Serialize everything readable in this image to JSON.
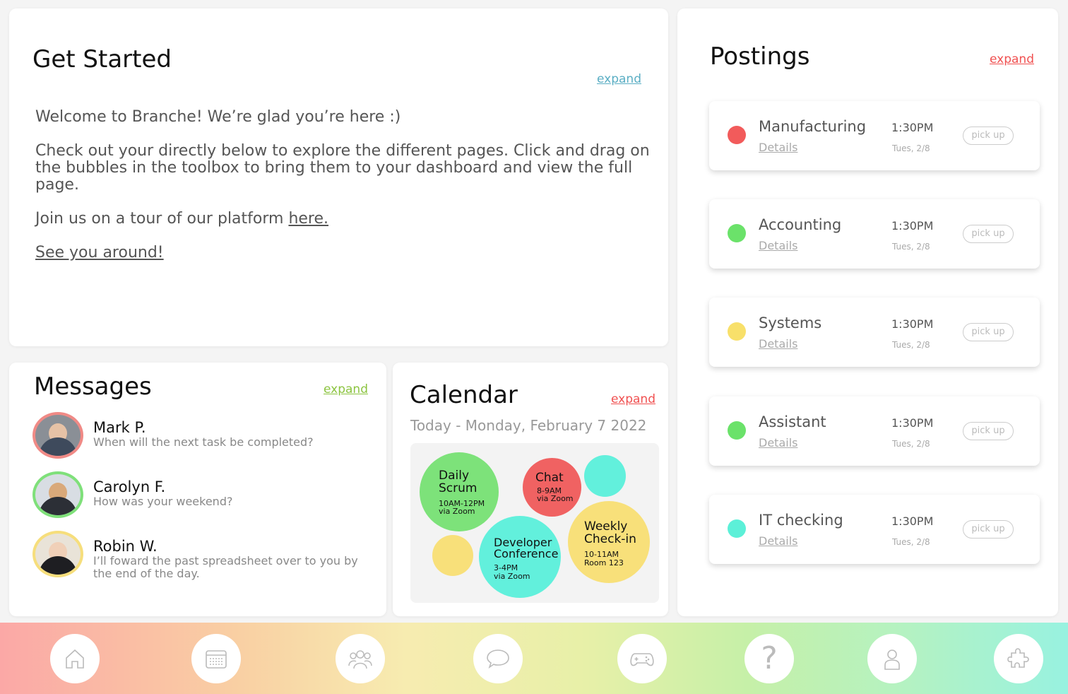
{
  "get_started": {
    "title": "Get Started",
    "expand": "expand",
    "welcome": "Welcome to Branche! We’re glad you’re here :)",
    "instructions": "Check out your directly below to explore the different pages. Click and drag on the bubbles in the toolbox to bring them to your dashboard and view the full page.",
    "tour_prefix": "Join us on a tour of our platform ",
    "tour_link": "here.",
    "signoff": "See you around!",
    "expand_color": "#5aaec4"
  },
  "messages": {
    "title": "Messages",
    "expand": "expand",
    "expand_color": "#8cc440",
    "items": [
      {
        "name": "Mark P.",
        "text": "When will the next task be completed?",
        "ring": "#f08a86"
      },
      {
        "name": "Carolyn F.",
        "text": "How was your weekend?",
        "ring": "#7fe07a"
      },
      {
        "name": "Robin W.",
        "text": "I’ll foward the past spreadsheet over to you by the end of the day.",
        "ring": "#f6de7c"
      }
    ]
  },
  "calendar": {
    "title": "Calendar",
    "expand": "expand",
    "expand_color": "#f05050",
    "today": "Today - Monday, February 7 2022",
    "events": [
      {
        "title_1": "Daily",
        "title_2": "Scrum",
        "sub_1": "10AM-12PM",
        "sub_2": "via Zoom",
        "color": "#7de27a"
      },
      {
        "title_1": "Chat",
        "sub_1": "8-9AM",
        "sub_2": "via Zoom",
        "color": "#f06262"
      },
      {
        "title_1": "Developer",
        "title_2": "Conference",
        "sub_1": "3-4PM",
        "sub_2": "via Zoom",
        "color": "#62f0dc"
      },
      {
        "title_1": "Weekly",
        "title_2": "Check-in",
        "sub_1": "10-11AM",
        "sub_2": "Room 123",
        "color": "#f8e07a"
      }
    ]
  },
  "postings": {
    "title": "Postings",
    "expand": "expand",
    "expand_color": "#f05050",
    "items": [
      {
        "name": "Manufacturing",
        "details": "Details",
        "time": "1:30PM",
        "date": "Tues, 2/8",
        "action": "pick up",
        "color": "#f25b5b"
      },
      {
        "name": "Accounting",
        "details": "Details",
        "time": "1:30PM",
        "date": "Tues, 2/8",
        "action": "pick up",
        "color": "#6be26a"
      },
      {
        "name": "Systems",
        "details": "Details",
        "time": "1:30PM",
        "date": "Tues, 2/8",
        "action": "pick up",
        "color": "#f8e06a"
      },
      {
        "name": "Assistant",
        "details": "Details",
        "time": "1:30PM",
        "date": "Tues, 2/8",
        "action": "pick up",
        "color": "#6be26a"
      },
      {
        "name": "IT checking",
        "details": "Details",
        "time": "1:30PM",
        "date": "Tues, 2/8",
        "action": "pick up",
        "color": "#5cf0d8"
      }
    ]
  },
  "toolbar": {
    "items": [
      "home-icon",
      "calendar-icon",
      "team-icon",
      "chat-icon",
      "gamepad-icon",
      "help-icon",
      "profile-icon",
      "puzzle-icon"
    ],
    "help_glyph": "?"
  }
}
